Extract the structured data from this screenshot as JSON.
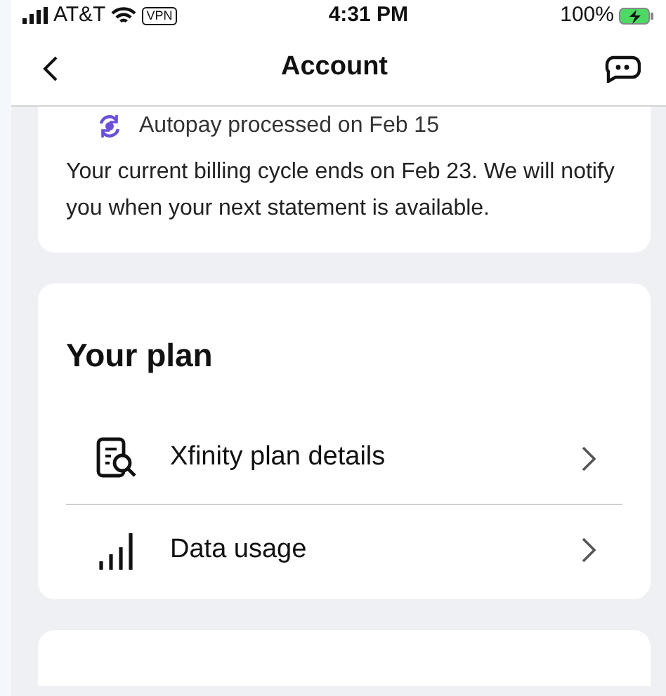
{
  "status_bar": {
    "carrier": "AT&T",
    "vpn": "VPN",
    "time": "4:31 PM",
    "battery": "100%"
  },
  "header": {
    "title": "Account"
  },
  "billing_card": {
    "autopay": "Autopay processed on Feb 15",
    "message": "Your current billing cycle ends on Feb 23. We will notify you when your next statement is available."
  },
  "plan_card": {
    "title": "Your plan",
    "items": [
      {
        "kind": "details",
        "label": "Xfinity plan details"
      },
      {
        "kind": "usage",
        "label": "Data usage"
      }
    ]
  }
}
